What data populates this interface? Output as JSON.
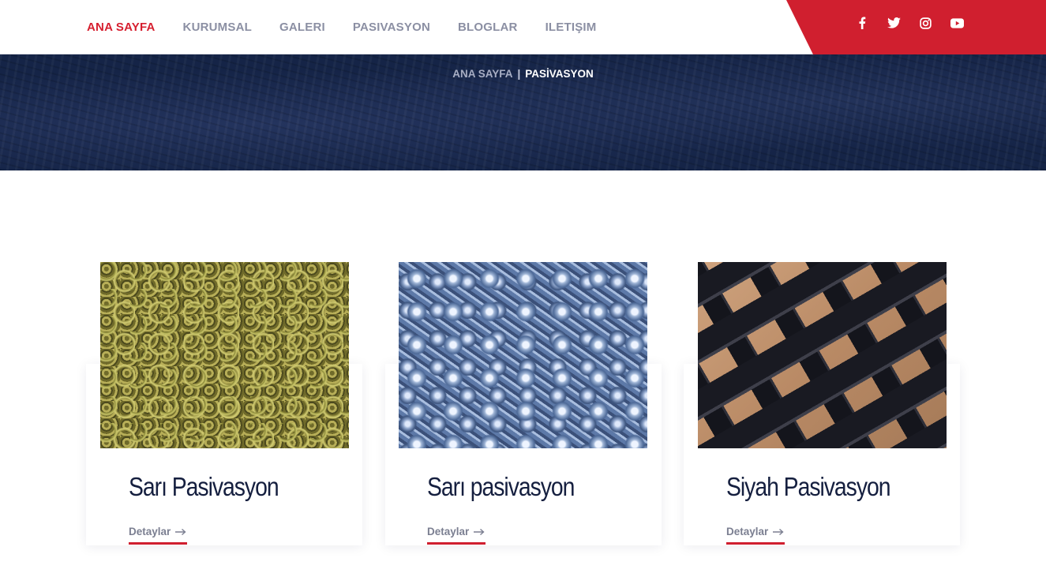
{
  "nav": {
    "items": [
      {
        "label": "ANA SAYFA",
        "active": true
      },
      {
        "label": "KURUMSAL",
        "active": false
      },
      {
        "label": "GALERI",
        "active": false
      },
      {
        "label": "PASIVASYON",
        "active": false
      },
      {
        "label": "BLOGLAR",
        "active": false
      },
      {
        "label": "ILETIŞIM",
        "active": false
      }
    ],
    "social": [
      "facebook-icon",
      "twitter-icon",
      "instagram-icon",
      "youtube-icon"
    ]
  },
  "breadcrumb": {
    "home": "ANA SAYFA",
    "separator": "|",
    "current": "PASİVASYON"
  },
  "cards": [
    {
      "title": "Sarı Pasivasyon",
      "link": "Detaylar",
      "image": "chain-image"
    },
    {
      "title": "Sarı pasivasyon",
      "link": "Detaylar",
      "image": "bolts-image"
    },
    {
      "title": "Siyah Pasivasyon",
      "link": "Detaylar",
      "image": "black-parts-image"
    }
  ],
  "colors": {
    "accent": "#d01f2f",
    "navy": "#152447",
    "title": "#151f3f",
    "muted": "#8b8fa3"
  }
}
